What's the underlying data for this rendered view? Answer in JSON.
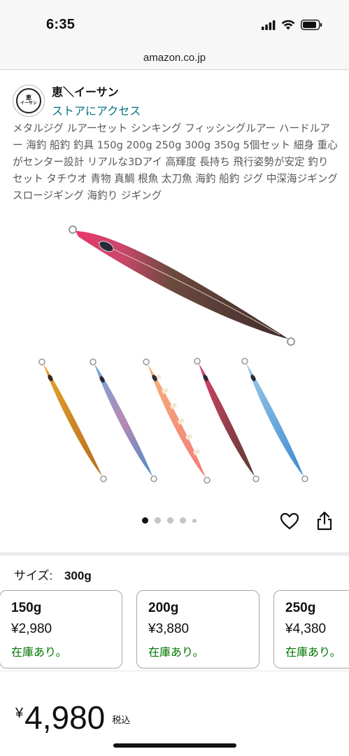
{
  "status_bar": {
    "time": "6:35",
    "icons": [
      "signal-icon",
      "wifi-icon",
      "battery-icon"
    ]
  },
  "browser": {
    "url": "amazon.co.jp"
  },
  "store": {
    "logo_text_top": "恵",
    "logo_text_bottom": "イーサン",
    "name": "恵＼イーサン",
    "link": "ストアにアクセス"
  },
  "product": {
    "title": "メタルジグ ルアーセット シンキング フィッシングルアー ハードルアー 海釣 船釣 釣具 150g 200g 250g 300g 350g 5個セット 細身 重心がセンター設計 リアルな3Dアイ 高輝度 長持ち 飛行姿勢が安定 釣りセット タチウオ 青物 真鯛 根魚 太刀魚 海釣 船釣 ジグ 中深海ジギング スロージギング 海釣り ジギング",
    "image_count": 5,
    "active_image": 1
  },
  "size": {
    "label": "サイズ:",
    "selected": "300g",
    "options": [
      {
        "weight": "150g",
        "price": "¥2,980",
        "stock": "在庫あり。"
      },
      {
        "weight": "200g",
        "price": "¥3,880",
        "stock": "在庫あり。"
      },
      {
        "weight": "250g",
        "price": "¥4,380",
        "stock": "在庫あり。"
      }
    ]
  },
  "price": {
    "currency": "¥",
    "amount": "4,980",
    "tax_label": "税込"
  },
  "colors": {
    "link": "#007185",
    "in_stock": "#007600",
    "text": "#0f1111",
    "muted": "#565959"
  }
}
